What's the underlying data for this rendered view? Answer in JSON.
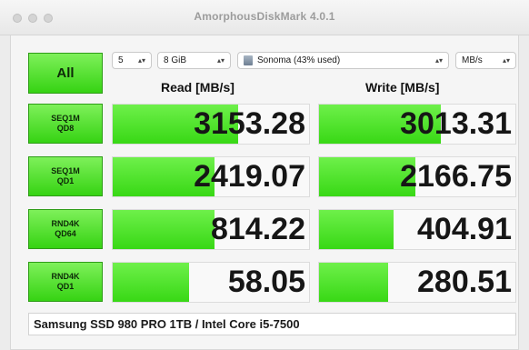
{
  "window": {
    "title": "AmorphousDiskMark 4.0.1"
  },
  "toolbar": {
    "all_label": "All",
    "count_select": {
      "value": "5"
    },
    "size_select": {
      "value": "8 GiB"
    },
    "disk_select": {
      "value": "Sonoma (43% used)"
    },
    "unit_select": {
      "value": "MB/s"
    }
  },
  "columns": {
    "read": "Read [MB/s]",
    "write": "Write [MB/s]"
  },
  "tests": [
    {
      "line1": "SEQ1M",
      "line2": "QD8",
      "read": "3153.28",
      "read_fill": 0.64,
      "write": "3013.31",
      "write_fill": 0.62
    },
    {
      "line1": "SEQ1M",
      "line2": "QD1",
      "read": "2419.07",
      "read_fill": 0.52,
      "write": "2166.75",
      "write_fill": 0.49
    },
    {
      "line1": "RND4K",
      "line2": "QD64",
      "read": "814.22",
      "read_fill": 0.52,
      "write": "404.91",
      "write_fill": 0.38
    },
    {
      "line1": "RND4K",
      "line2": "QD1",
      "read": "58.05",
      "read_fill": 0.39,
      "write": "280.51",
      "write_fill": 0.35
    }
  ],
  "comment": "Samsung SSD 980 PRO 1TB / Intel Core i5-7500",
  "colors": {
    "accent_green": "#38d815",
    "button_green": "#36d313"
  }
}
